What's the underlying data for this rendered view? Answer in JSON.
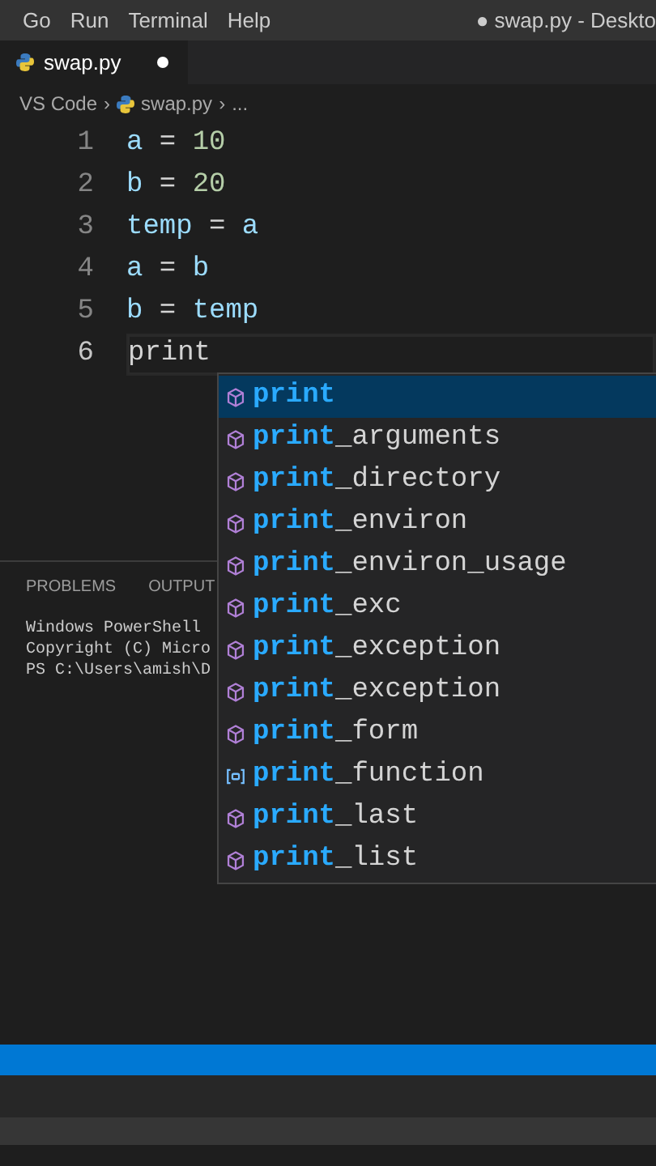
{
  "menu_bar": {
    "items": [
      "Go",
      "Run",
      "Terminal",
      "Help"
    ],
    "title": "● swap.py - Deskto"
  },
  "tabs": [
    {
      "label": "swap.py",
      "selected": true,
      "modified": true
    }
  ],
  "breadcrumb": {
    "separator": "›",
    "items": [
      "VS Code",
      "swap.py",
      "..."
    ]
  },
  "editor": {
    "lines": [
      {
        "number": "1",
        "current": false,
        "tokens": [
          {
            "text": "a",
            "kind": "var"
          },
          {
            "text": " = ",
            "kind": "op"
          },
          {
            "text": "10",
            "kind": "num"
          }
        ]
      },
      {
        "number": "2",
        "current": false,
        "tokens": [
          {
            "text": "b",
            "kind": "var"
          },
          {
            "text": " = ",
            "kind": "op"
          },
          {
            "text": "20",
            "kind": "num"
          }
        ]
      },
      {
        "number": "3",
        "current": false,
        "tokens": [
          {
            "text": "temp",
            "kind": "var"
          },
          {
            "text": " = ",
            "kind": "op"
          },
          {
            "text": "a",
            "kind": "var"
          }
        ]
      },
      {
        "number": "4",
        "current": false,
        "tokens": [
          {
            "text": "a",
            "kind": "var"
          },
          {
            "text": " = ",
            "kind": "op"
          },
          {
            "text": "b",
            "kind": "var"
          }
        ]
      },
      {
        "number": "5",
        "current": false,
        "tokens": [
          {
            "text": "b",
            "kind": "var"
          },
          {
            "text": " = ",
            "kind": "op"
          },
          {
            "text": "temp",
            "kind": "var"
          }
        ]
      },
      {
        "number": "6",
        "current": true,
        "tokens": [
          {
            "text": "print",
            "kind": "plain"
          }
        ]
      }
    ]
  },
  "panel": {
    "tabs": [
      "PROBLEMS",
      "OUTPUT"
    ],
    "terminal_lines": [
      "Windows PowerShell",
      "Copyright (C) Micro",
      "PS C:\\Users\\amish\\D"
    ]
  },
  "suggestions": [
    {
      "match": "print",
      "kind": "method",
      "selected": true
    },
    {
      "match": "print",
      "rest": "_arguments",
      "kind": "method",
      "selected": false
    },
    {
      "match": "print",
      "rest": "_directory",
      "kind": "method",
      "selected": false
    },
    {
      "match": "print",
      "rest": "_environ",
      "kind": "method",
      "selected": false
    },
    {
      "match": "print",
      "rest": "_environ_usage",
      "kind": "method",
      "selected": false
    },
    {
      "match": "print",
      "rest": "_exc",
      "kind": "method",
      "selected": false
    },
    {
      "match": "print",
      "rest": "_exception",
      "kind": "method",
      "selected": false
    },
    {
      "match": "print",
      "rest": "_exception",
      "kind": "method",
      "selected": false
    },
    {
      "match": "print",
      "rest": "_form",
      "kind": "method",
      "selected": false
    },
    {
      "match": "print",
      "rest": "_function",
      "kind": "variable",
      "selected": false
    },
    {
      "match": "print",
      "rest": "_last",
      "kind": "method",
      "selected": false
    },
    {
      "match": "print",
      "rest": "_list",
      "kind": "method",
      "selected": false
    }
  ]
}
